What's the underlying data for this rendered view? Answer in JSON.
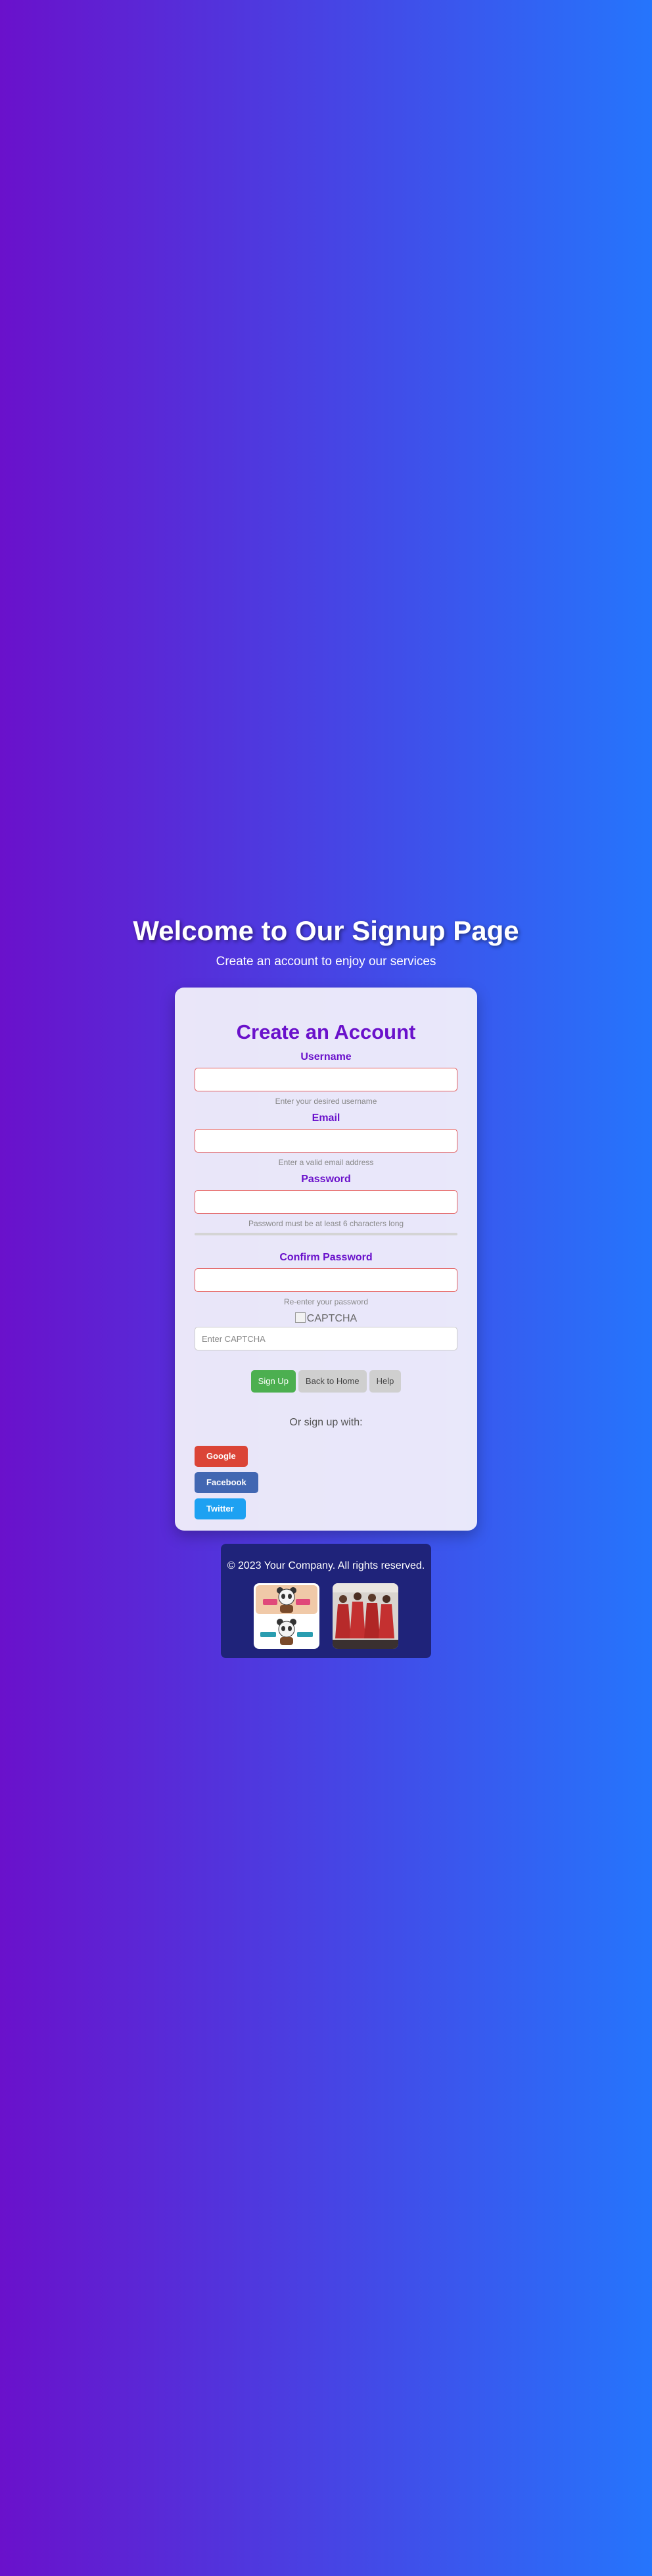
{
  "hero": {
    "title": "Welcome to Our Signup Page",
    "subtitle": "Create an account to enjoy our services"
  },
  "form": {
    "title": "Create an Account",
    "fields": [
      {
        "label": "Username",
        "value": "",
        "hint": "Enter your desired username"
      },
      {
        "label": "Email",
        "value": "",
        "hint": "Enter a valid email address"
      },
      {
        "label": "Password",
        "value": "",
        "hint": "Password must be at least 6 characters long"
      },
      {
        "label": "Confirm Password",
        "value": "",
        "hint": "Re-enter your password"
      }
    ],
    "password_strength": 0,
    "captcha": {
      "image_alt": "CAPTCHA",
      "placeholder": "Enter CAPTCHA",
      "value": ""
    },
    "buttons": {
      "signup": "Sign Up",
      "back": "Back to Home",
      "help": "Help"
    },
    "social_prompt": "Or sign up with:",
    "social": [
      {
        "label": "Google",
        "color": "#db4437",
        "icon": "google-icon"
      },
      {
        "label": "Facebook",
        "color": "#4267b2",
        "icon": "facebook-icon"
      },
      {
        "label": "Twitter",
        "color": "#1da1f2",
        "icon": "twitter-icon"
      }
    ]
  },
  "footer": {
    "copyright": "© 2023 Your Company. All rights reserved.",
    "images": [
      "panda-sticker-image",
      "group-photo-image"
    ]
  },
  "colors": {
    "gradient_start": "#6a11cb",
    "gradient_end": "#2575fc",
    "accent": "#6a11cb",
    "primary_button": "#4caf50",
    "footer_bg": "#1f237a"
  }
}
